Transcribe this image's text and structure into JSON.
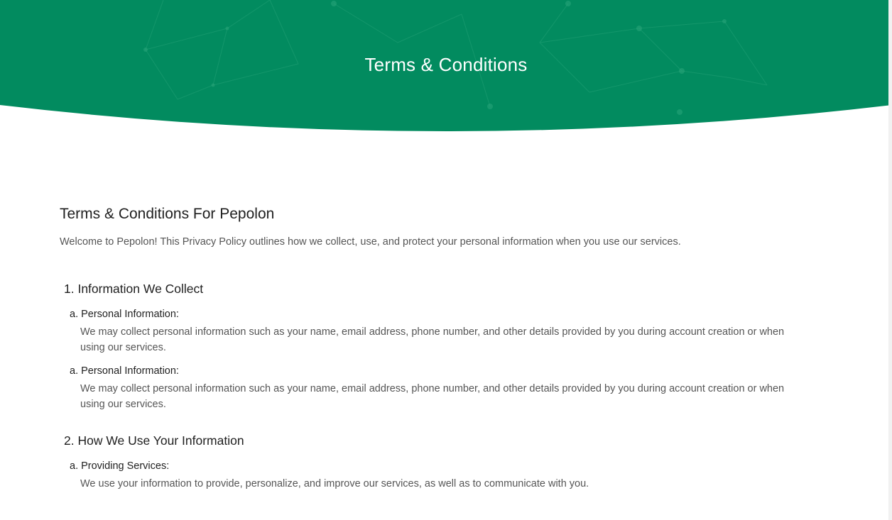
{
  "hero": {
    "title": "Terms & Conditions",
    "color": "#028b5f"
  },
  "main": {
    "heading": "Terms & Conditions For Pepolon",
    "intro": "Welcome to Pepolon! This Privacy Policy outlines how we collect, use, and protect your personal information when you use our services.",
    "sections": [
      {
        "title": "1. Information We Collect",
        "items": [
          {
            "title": "a. Personal Information:",
            "body": "We may collect personal information such as your name, email address, phone number, and other details provided by you during account creation or when using our services."
          },
          {
            "title": "a. Personal Information:",
            "body": "We may collect personal information such as your name, email address, phone number, and other details provided by you during account creation or when using our services."
          }
        ]
      },
      {
        "title": "2. How We Use Your Information",
        "items": [
          {
            "title": "a. Providing Services:",
            "body": "We use your information to provide, personalize, and improve our services, as well as to communicate with you."
          }
        ]
      }
    ]
  }
}
